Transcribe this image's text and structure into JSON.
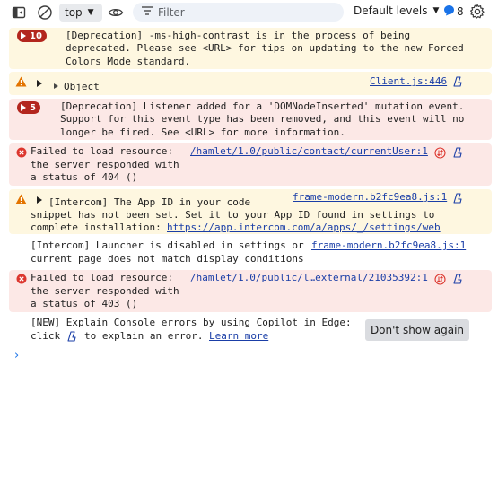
{
  "toolbar": {
    "context": "top",
    "filter_placeholder": "Filter",
    "levels": "Default levels",
    "issues_count": "8"
  },
  "messages": [
    {
      "kind": "warning",
      "badge": "10",
      "lines": [
        "[Deprecation] -ms-high-contrast is in the process of being",
        "deprecated. Please see <URL> for tips on updating to the new Forced",
        "Colors Mode standard."
      ]
    },
    {
      "kind": "warning",
      "text": "Object",
      "source": "Client.js:446"
    },
    {
      "kind": "error",
      "badge": "5",
      "lines": [
        "[Deprecation] Listener added for a 'DOMNodeInserted' mutation event.",
        "Support for this event type has been removed, and this event will no",
        "longer be fired. See <URL> for more information."
      ]
    },
    {
      "kind": "error",
      "lines": [
        "Failed to load resource:",
        "the server responded with",
        "a status of 404 ()"
      ],
      "source": "/hamlet/1.0/public/contact/currentUser:1"
    },
    {
      "kind": "warning",
      "lines": [
        "[Intercom] The App ID in your code",
        "snippet has not been set. Set it to your App ID found in settings to",
        "complete installation: "
      ],
      "url": "https://app.intercom.com/a/apps/_/settings/web",
      "source": "frame-modern.b2fc9ea8.js:1"
    },
    {
      "kind": "log",
      "lines": [
        "[Intercom] Launcher is disabled in settings or",
        "current page does not match display conditions"
      ],
      "source": "frame-modern.b2fc9ea8.js:1"
    },
    {
      "kind": "error",
      "lines": [
        "Failed to load resource:",
        "the server responded with",
        "a status of 403 ()"
      ],
      "source": "/hamlet/1.0/public/l…external/21035392:1"
    }
  ],
  "copilot": {
    "line1": "[NEW] Explain Console errors by using Copilot in Edge:",
    "line2_before": "click",
    "line2_after": "to explain an error.",
    "learn_more": "Learn more",
    "dont_show": "Don't show again"
  },
  "colors": {
    "warning_bg": "#fef7e0",
    "error_bg": "#fce8e6",
    "error_accent": "#b3261e",
    "warning_accent": "#e37400",
    "link": "#1a3ea7",
    "prompt": "#1a73e8"
  }
}
